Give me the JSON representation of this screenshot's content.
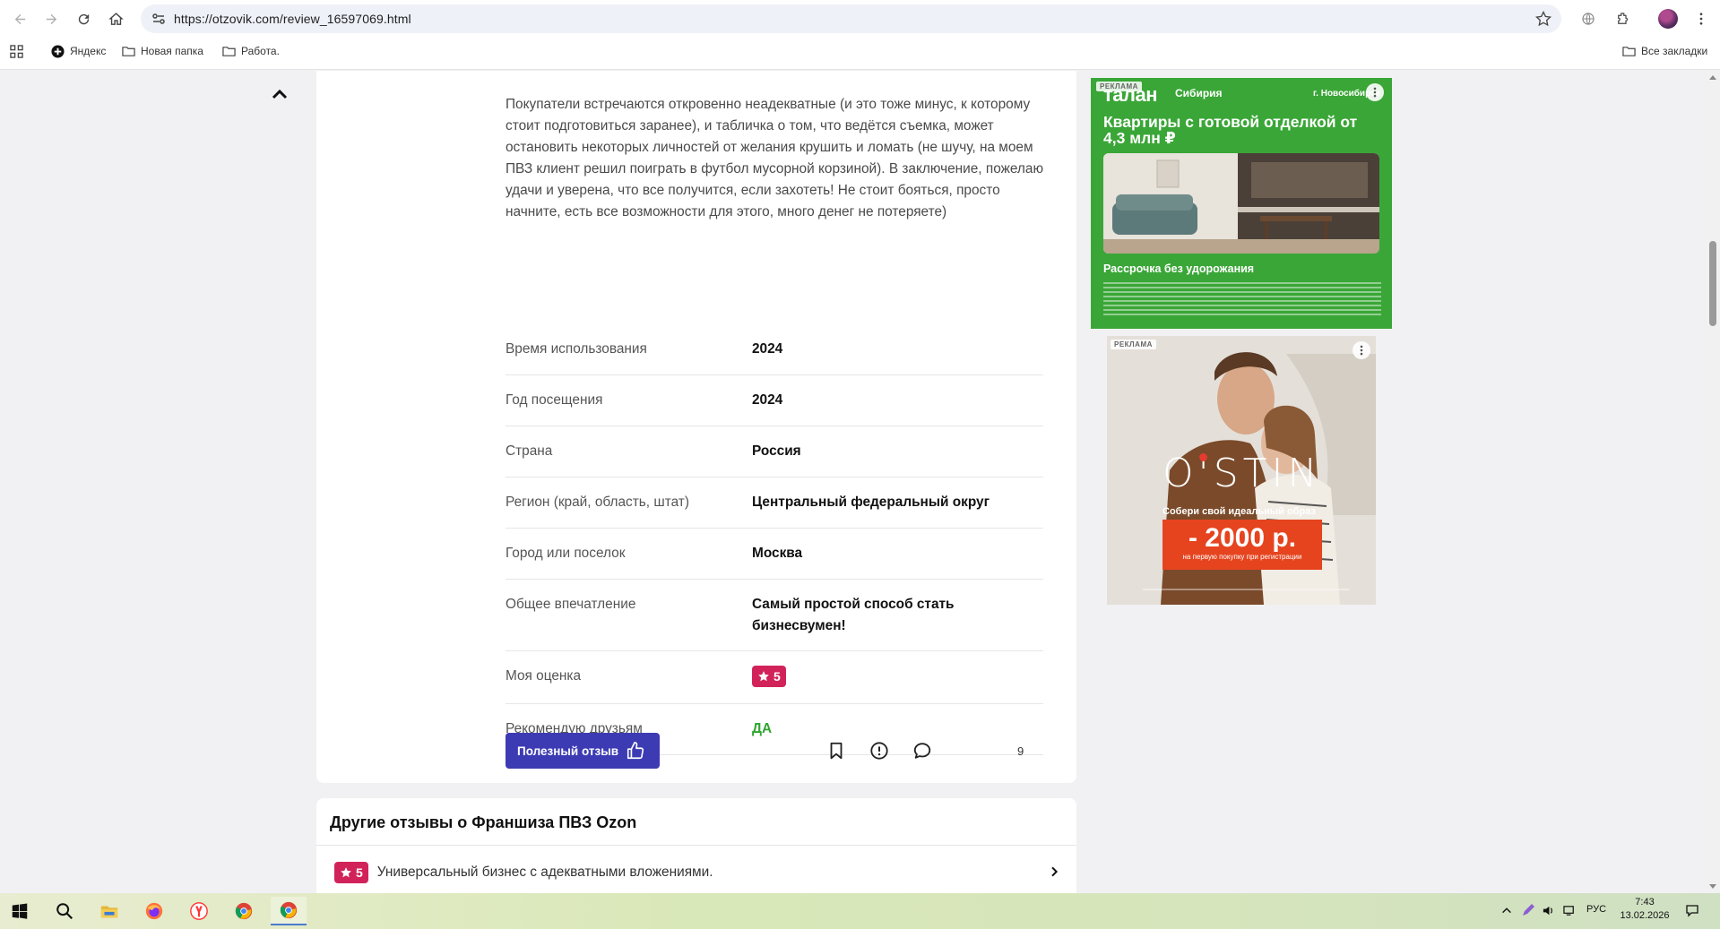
{
  "browser": {
    "url": "https://otzovik.com/review_16597069.html",
    "bookmarks": [
      {
        "label": "Яндекс"
      },
      {
        "label": "Новая папка"
      },
      {
        "label": "Работа."
      }
    ],
    "all_bookmarks_label": "Все закладки"
  },
  "review": {
    "text": "Покупатели встречаются откровенно неадекватные (и это тоже минус, к которому стоит подготовиться заранее), и табличка о том, что ведётся съемка, может остановить некоторых личностей от желания крушить и ломать (не шучу, на моем ПВЗ клиент решил поиграть в футбол мусорной корзиной). В заключение, пожелаю удачи и уверена, что все получится, если захотеть! Не стоит бояться, просто начните, есть все возможности для этого, много денег не потеряете)",
    "properties": [
      {
        "label": "Время использования",
        "value": "2024"
      },
      {
        "label": "Год посещения",
        "value": "2024"
      },
      {
        "label": "Страна",
        "value": "Россия"
      },
      {
        "label": "Регион (край, область, штат)",
        "value": "Центральный федеральный округ"
      },
      {
        "label": "Город или поселок",
        "value": "Москва"
      },
      {
        "label": "Общее впечатление",
        "value": "Самый простой способ стать бизнесвумен!"
      },
      {
        "label": "Моя оценка",
        "value": "5"
      },
      {
        "label": "Рекомендую друзьям",
        "value": "ДА"
      }
    ],
    "useful_button": "Полезный отзыв",
    "comments_count": "9"
  },
  "other_reviews": {
    "title": "Другие отзывы о Франшиза ПВЗ Ozon",
    "items": [
      {
        "rating": "5",
        "title": "Универсальный бизнес с адекватными вложениями."
      }
    ]
  },
  "ads": {
    "ad1": {
      "tag": "РЕКЛАМА",
      "brand": "талан",
      "region": "Сибирия",
      "city": "г. Новосибирск",
      "headline": "Квартиры с готовой отделкой от 4,3 млн ₽",
      "tagline": "Рассрочка без удорожания",
      "color": "#3aa637"
    },
    "ad2": {
      "tag": "РЕКЛАМА",
      "logo": "O'STIN",
      "sub": "Собери свой идеальный образ",
      "promo": "- 2000 р.",
      "promo_note": "на первую покупку при регистрации",
      "color": "#e5441f"
    }
  },
  "taskbar": {
    "lang": "РУС",
    "time": "7:43",
    "date": "13.02.2026"
  },
  "colors": {
    "accent_button": "#3c3bb3",
    "rating_badge": "#d1235a",
    "recommend_yes": "#2fa52f"
  }
}
